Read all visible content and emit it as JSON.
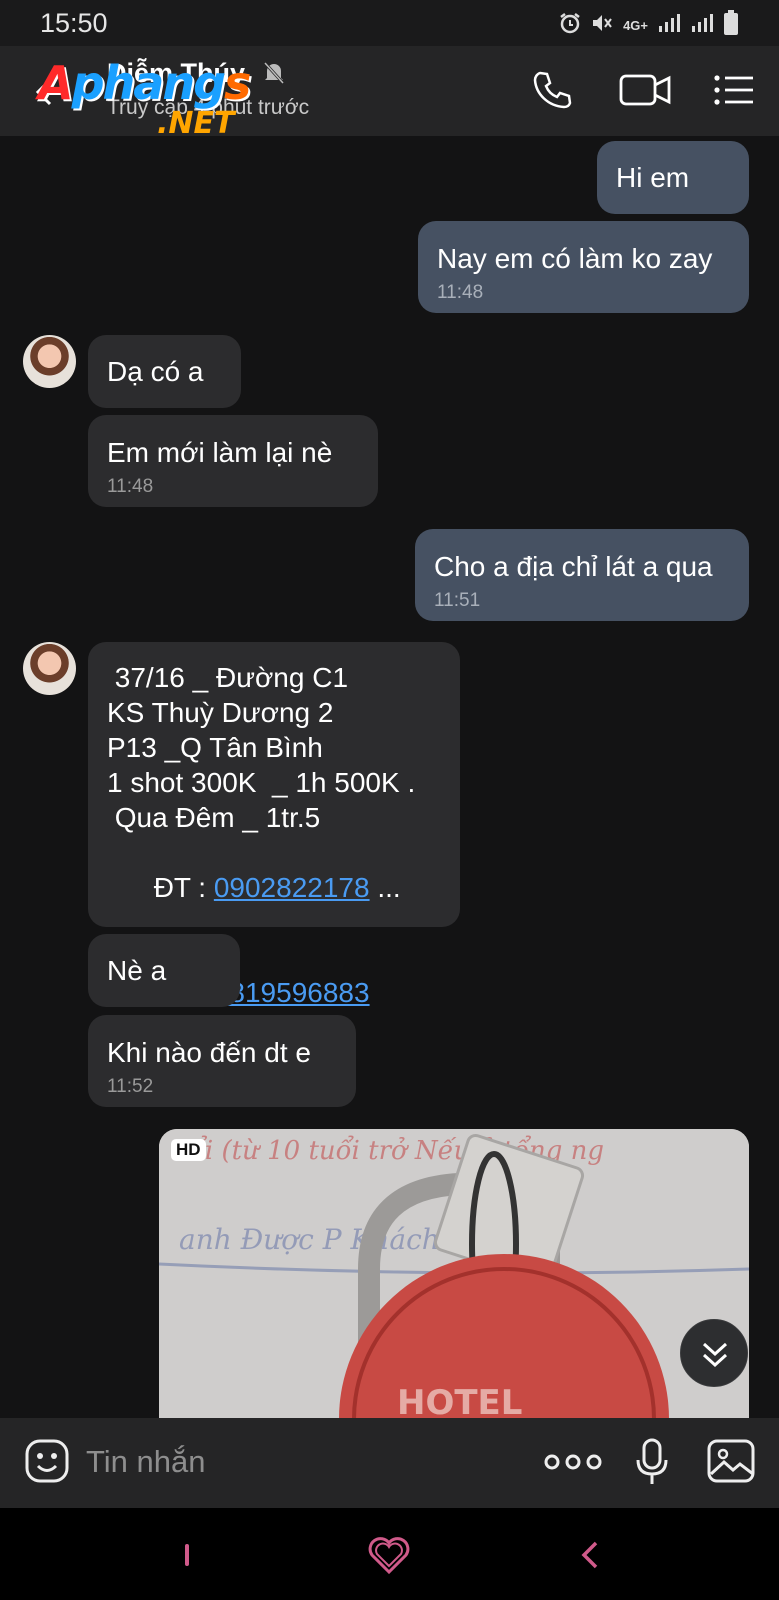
{
  "status_bar": {
    "time": "15:50",
    "network": "4G+"
  },
  "header": {
    "contact_name": "Diễm Thúy",
    "contact_status": "Truy cập 4 phút trước",
    "watermark_main": "Aphangs",
    "watermark_net": ".NET"
  },
  "messages": [
    {
      "dir": "out",
      "text": "Hi em",
      "time": ""
    },
    {
      "dir": "out",
      "text": "Nay em có làm ko zay",
      "time": "11:48"
    },
    {
      "dir": "in",
      "text": "Dạ  có  a",
      "time": ""
    },
    {
      "dir": "in",
      "text": "Em mới làm lại  nè",
      "time": "11:48"
    },
    {
      "dir": "out",
      "text": "Cho a địa chỉ lát a qua",
      "time": "11:51"
    },
    {
      "dir": "in",
      "lines": [
        " 37/16 _ Đường C1",
        "KS Thuỳ Dương 2",
        "P13 _Q Tân Bình",
        "1 shot 300K  _ 1h 500K .",
        " Qua Đêm _ 1tr.5"
      ],
      "phone_prefix": "ĐT : ",
      "phone1": "0902822178",
      "phone1_suffix": " ...",
      "phone2": "0819596883",
      "time": ""
    },
    {
      "dir": "in",
      "text": "Nè  a",
      "time": ""
    },
    {
      "dir": "in",
      "text": "Khi nào  đến  dt e",
      "time": "11:52"
    }
  ],
  "photo": {
    "badge": "HD"
  },
  "input": {
    "placeholder": "Tin nhắn"
  },
  "colors": {
    "outgoing": "#465162",
    "incoming": "#2c2c2e",
    "background": "#131314",
    "link": "#4a9bf2"
  }
}
